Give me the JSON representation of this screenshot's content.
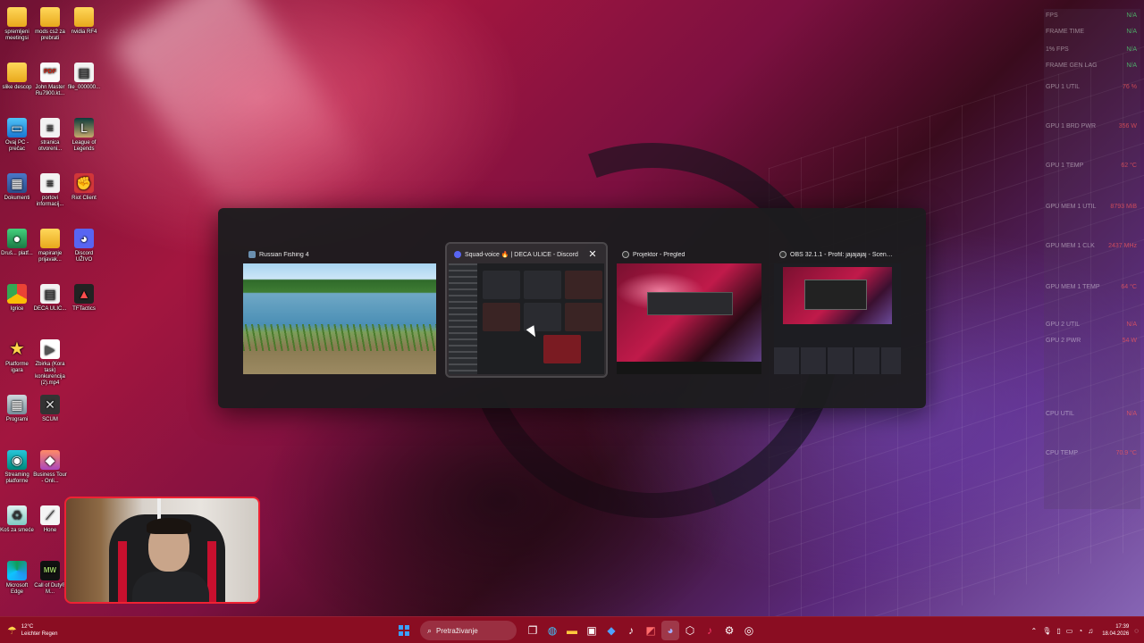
{
  "desktop_icons": [
    {
      "label": "spremljeni meetingsi",
      "icon": "folder-icon"
    },
    {
      "label": "mods cs2 za prebrati",
      "icon": "folder-icon"
    },
    {
      "label": "nvidia RF4",
      "icon": "folder-icon"
    },
    {
      "label": "slike descop",
      "icon": "folder-icon"
    },
    {
      "label": "John Master Ru7900.kt...",
      "icon": "pdf-icon"
    },
    {
      "label": "file_000000...",
      "icon": "file-icon"
    },
    {
      "label": "Ovaj PC - prečac",
      "icon": "computer-icon"
    },
    {
      "label": "stranica otvoreni...",
      "icon": "document-icon"
    },
    {
      "label": "League of Legends",
      "icon": "league-of-legends-icon"
    },
    {
      "label": "Dokumenti",
      "icon": "documents-icon"
    },
    {
      "label": "portovi informacij...",
      "icon": "document-icon"
    },
    {
      "label": "Riot Client",
      "icon": "riot-client-icon"
    },
    {
      "label": "Druš... platf...",
      "icon": "app-icon"
    },
    {
      "label": "mapiranje prijavak...",
      "icon": "folder-icon"
    },
    {
      "label": "Discord UŽIVO",
      "icon": "discord-icon"
    },
    {
      "label": "Igrice",
      "icon": "chrome-icon"
    },
    {
      "label": "DECA ULIC...",
      "icon": "file-icon"
    },
    {
      "label": "TFTactics",
      "icon": "tftactics-icon"
    },
    {
      "label": "Platforme igara",
      "icon": "star-icon"
    },
    {
      "label": "Zbirka (Kora task) konkurencija (2).mp4",
      "icon": "video-icon"
    },
    {
      "label": "Programi",
      "icon": "programs-icon"
    },
    {
      "label": "SCUM",
      "icon": "scum-icon"
    },
    {
      "label": "Streaming platforme",
      "icon": "streaming-icon"
    },
    {
      "label": "Business Tour - Onli...",
      "icon": "business-tour-icon"
    },
    {
      "label": "Koš za smeće",
      "icon": "recycle-bin-icon"
    },
    {
      "label": "Hone",
      "icon": "hone-icon"
    },
    {
      "label": "Microsoft Edge",
      "icon": "edge-icon"
    },
    {
      "label": "Call of Duty® M...",
      "icon": "call-of-duty-icon"
    }
  ],
  "perf_overlay": [
    {
      "label": "FPS",
      "value": "N/A"
    },
    {
      "label": "FRAME TIME",
      "value": "N/A"
    },
    {
      "label": "1% FPS",
      "value": "N/A"
    },
    {
      "label": "FRAME GEN LAG",
      "value": "N/A"
    },
    {
      "label": "GPU 1 UTIL",
      "value": "76 %"
    },
    {
      "label": "GPU 1 BRD PWR",
      "value": "356 W"
    },
    {
      "label": "GPU 1 TEMP",
      "value": "62 °C"
    },
    {
      "label": "GPU MEM 1 UTIL",
      "value": "8793 MiB"
    },
    {
      "label": "GPU MEM 1 CLK",
      "value": "2437 MHz"
    },
    {
      "label": "GPU MEM 1 TEMP",
      "value": "64 °C"
    },
    {
      "label": "GPU 2 UTIL",
      "value": "N/A"
    },
    {
      "label": "GPU 2 PWR",
      "value": "54 W"
    },
    {
      "label": "CPU UTIL",
      "value": "N/A"
    },
    {
      "label": "CPU TEMP",
      "value": "70.9 °C"
    }
  ],
  "switcher": {
    "windows": [
      {
        "title": "Russian Fishing 4",
        "icon": "fishing-app-icon"
      },
      {
        "title": "Squad-voice 🔥 | DECA ULICE - Discord",
        "icon": "discord-icon",
        "close": "✕"
      },
      {
        "title": "Projektor - Pregled",
        "icon": "obs-icon"
      },
      {
        "title": "OBS 32.1.1 - Profil: jajajajaj - Scene: Nenasl...",
        "icon": "obs-icon"
      }
    ]
  },
  "taskbar": {
    "weather_temp": "12°C",
    "weather_desc": "Leichter Regen",
    "search_placeholder": "Pretraživanje",
    "time": "17:39",
    "date": "18.04.2026"
  },
  "colors": {
    "taskbar_bg": "#8a0d22",
    "switcher_bg": "#1c1c1e",
    "webcam_border": "#ee2233"
  }
}
